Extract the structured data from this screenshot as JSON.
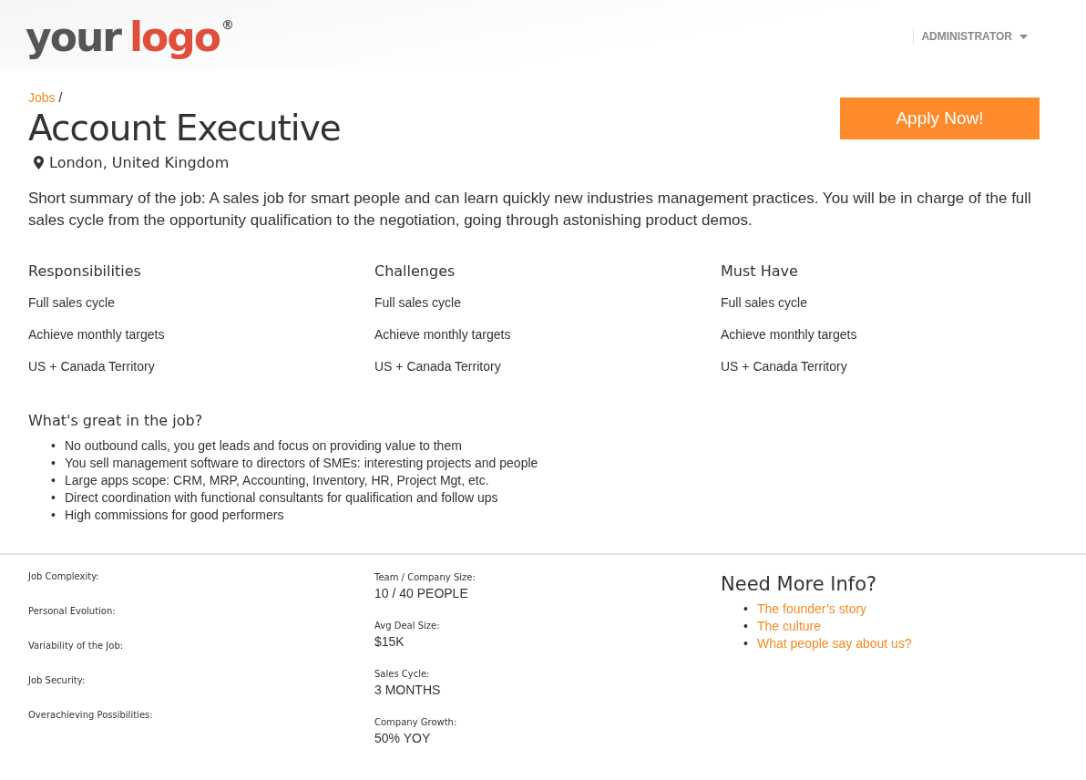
{
  "header": {
    "logo": {
      "dark": "your",
      "accent": "logo",
      "mark": "®"
    },
    "user_menu": "ADMINISTRATOR"
  },
  "breadcrumb": {
    "link": "Jobs",
    "separator": "/"
  },
  "job": {
    "title": "Account Executive",
    "location": "London, United Kingdom",
    "apply_button": "Apply Now!",
    "summary": "Short summary of the job: A sales job for smart people and can learn quickly new industries management practices. You will be in charge of the full sales cycle from the opportunity qualification to the negotiation, going through astonishing product demos."
  },
  "columns": [
    {
      "title": "Responsibilities",
      "items": [
        "Full sales cycle",
        "Achieve monthly targets",
        "US + Canada Territory"
      ]
    },
    {
      "title": "Challenges",
      "items": [
        "Full sales cycle",
        "Achieve monthly targets",
        "US + Canada Territory"
      ]
    },
    {
      "title": "Must Have",
      "items": [
        "Full sales cycle",
        "Achieve monthly targets",
        "US + Canada Territory"
      ]
    }
  ],
  "great": {
    "title": "What's great in the job?",
    "marker": "•",
    "items": [
      "No outbound calls, you get leads and focus on providing value to them",
      "You sell management software to directors of SMEs: interesting projects and people",
      "Large apps scope: CRM, MRP, Accounting, Inventory, HR, Project Mgt, etc.",
      "Direct coordination with functional consultants for qualification and follow ups",
      "High commissions for good performers"
    ]
  },
  "ratings": [
    "Job Complexity:",
    "Personal Evolution:",
    "Variability of the Job:",
    "Job Security:",
    "Overachieving Possibilities:"
  ],
  "facts": [
    {
      "label": "Team / Company Size:",
      "value": "10 / 40 PEOPLE"
    },
    {
      "label": "Avg Deal Size:",
      "value": "$15K"
    },
    {
      "label": "Sales Cycle:",
      "value": "3 MONTHS"
    },
    {
      "label": "Company Growth:",
      "value": "50% YOY"
    }
  ],
  "more_info": {
    "title": "Need More Info?",
    "marker": "•",
    "links": [
      "The founder’s story",
      "The culture",
      "What people say about us?"
    ]
  }
}
